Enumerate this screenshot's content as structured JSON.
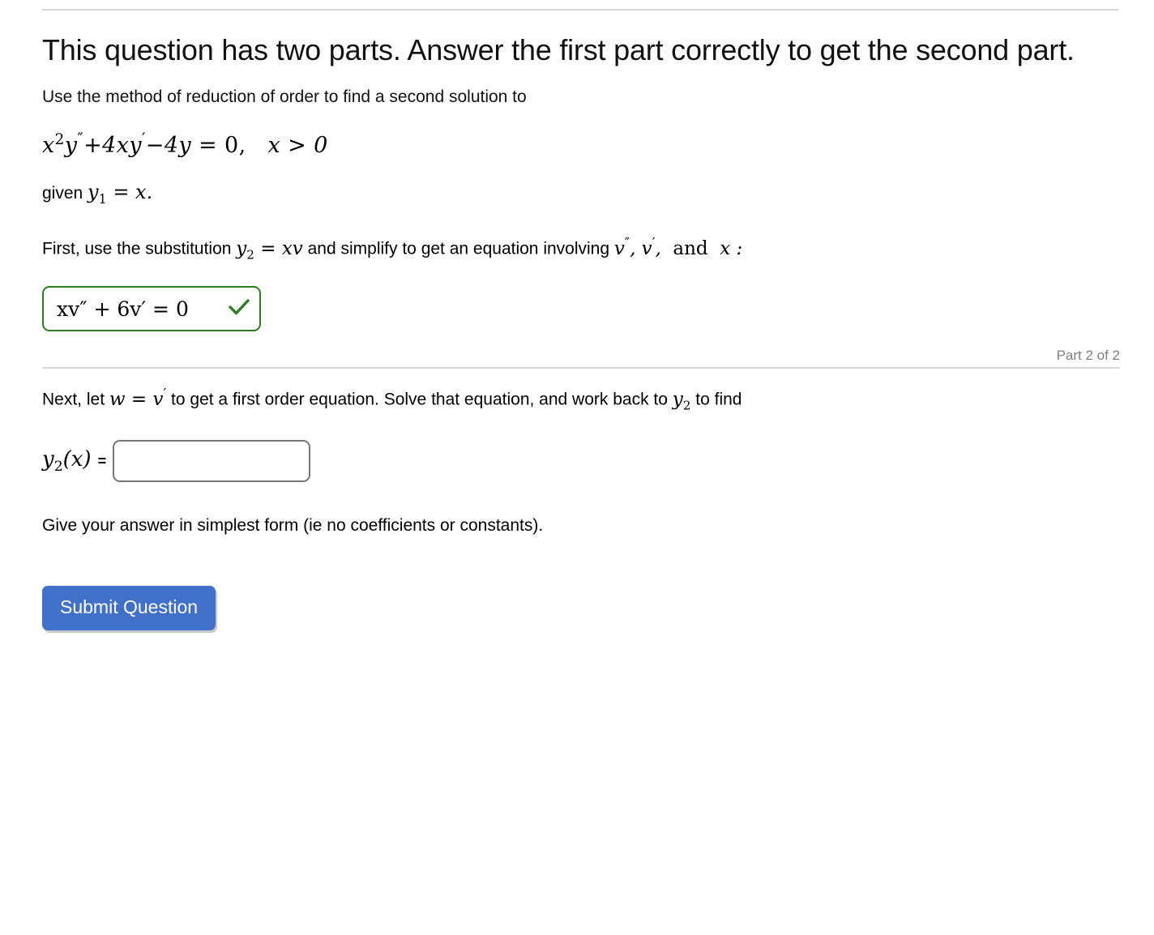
{
  "page": {
    "title": "This question has two parts. Answer the first part correctly to get the second part.",
    "intro": "Use the method of reduction of order to find a second solution to",
    "equation": {
      "full": "x²y″+4xy′−4y = 0,  x > 0",
      "lhs_var": "x",
      "terms": [
        "x²y″",
        "+4xy′",
        "−4y"
      ],
      "rhs": "0",
      "domain": "x > 0"
    },
    "given": {
      "prefix": "given ",
      "expression": "y₁ = x.",
      "y1_value": "x"
    },
    "part1": {
      "instruction_before": "First, use the substitution ",
      "substitution": "y₂ = xv",
      "instruction_middle": " and simplify to get an equation involving ",
      "involving": "v″, v′,  and  x :",
      "answer_value": "xv″ + 6v′ = 0",
      "status": "correct",
      "check_icon": "check-icon",
      "border_color": "#2f7d22"
    },
    "part_label": "Part 2 of 2",
    "part2": {
      "instruction_before": "Next, let ",
      "let_expression": "w = v′",
      "instruction_after": " to get a first order equation. Solve that equation, and work back to ",
      "target": "y₂",
      "instruction_end": " to find",
      "answer_label": "y₂(x)",
      "equals": "=",
      "answer_input_value": "",
      "answer_input_placeholder": ""
    },
    "note": "Give your answer in simplest form (ie no coefficients or constants).",
    "submit_label": "Submit Question",
    "colors": {
      "submit_blue": "#4170c8",
      "correct_green": "#2f7d22",
      "divider_gray": "#d8d8d8",
      "part_label_gray": "#808080",
      "input_border_gray": "#767676"
    }
  }
}
